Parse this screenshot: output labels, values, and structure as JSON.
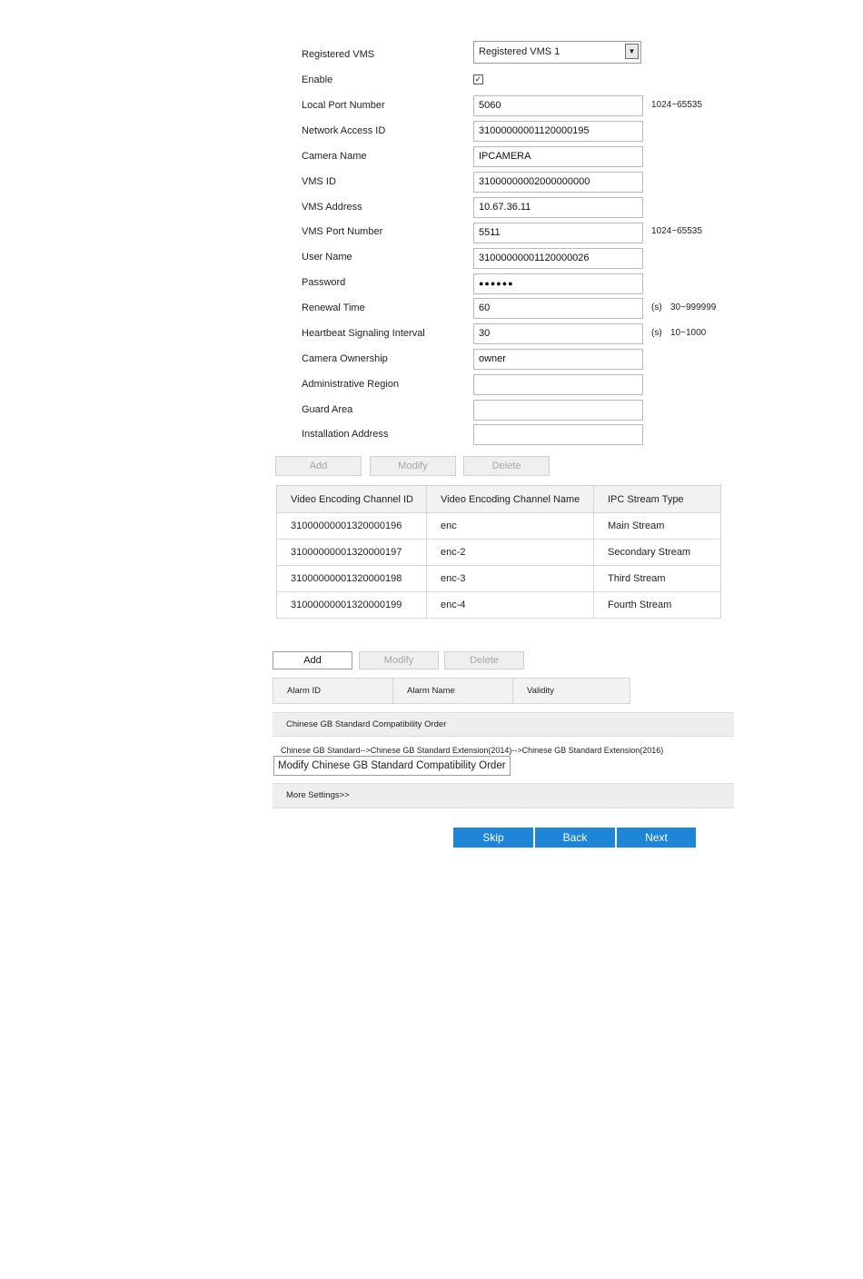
{
  "form": {
    "registered_vms": {
      "label": "Registered VMS",
      "value": "Registered VMS 1"
    },
    "enable": {
      "label": "Enable",
      "checked": true
    },
    "local_port": {
      "label": "Local Port Number",
      "value": "5060",
      "hint": "1024~65535"
    },
    "network_access_id": {
      "label": "Network Access ID",
      "value": "31000000001120000195"
    },
    "camera_name": {
      "label": "Camera Name",
      "value": "IPCAMERA"
    },
    "vms_id": {
      "label": "VMS ID",
      "value": "31000000002000000000"
    },
    "vms_address": {
      "label": "VMS Address",
      "value": "10.67.36.11"
    },
    "vms_port": {
      "label": "VMS Port Number",
      "value": "5511",
      "hint": "1024~65535"
    },
    "user_name": {
      "label": "User Name",
      "value": "31000000001120000026"
    },
    "password": {
      "label": "Password",
      "value": "●●●●●●"
    },
    "renewal_time": {
      "label": "Renewal Time",
      "value": "60",
      "unit": "(s)",
      "hint": "30~999999"
    },
    "heartbeat": {
      "label": "Heartbeat Signaling Interval",
      "value": "30",
      "unit": "(s)",
      "hint": "10~1000"
    },
    "camera_ownership": {
      "label": "Camera Ownership",
      "value": "owner"
    },
    "admin_region": {
      "label": "Administrative Region",
      "value": ""
    },
    "guard_area": {
      "label": "Guard Area",
      "value": ""
    },
    "install_address": {
      "label": "Installation Address",
      "value": ""
    }
  },
  "channel_buttons": {
    "add": "Add",
    "modify": "Modify",
    "delete": "Delete"
  },
  "channel_table": {
    "headers": [
      "Video Encoding Channel ID",
      "Video Encoding Channel Name",
      "IPC Stream Type"
    ],
    "rows": [
      [
        "31000000001320000196",
        "enc",
        "Main Stream"
      ],
      [
        "31000000001320000197",
        "enc-2",
        "Secondary Stream"
      ],
      [
        "31000000001320000198",
        "enc-3",
        "Third Stream"
      ],
      [
        "31000000001320000199",
        "enc-4",
        "Fourth Stream"
      ]
    ]
  },
  "alarm_buttons": {
    "add": "Add",
    "modify": "Modify",
    "delete": "Delete"
  },
  "alarm_table": {
    "headers": [
      "Alarm ID",
      "Alarm Name",
      "Validity"
    ]
  },
  "compat": {
    "section_title": "Chinese GB Standard Compatibility Order",
    "order_text": "Chinese GB Standard-->Chinese GB Standard Extension(2014)-->Chinese GB Standard Extension(2016)",
    "modify_button": "Modify Chinese GB Standard Compatibility Order"
  },
  "more_settings": "More Settings>>",
  "nav": {
    "skip": "Skip",
    "back": "Back",
    "next": "Next",
    "color": "#1f85d6"
  }
}
